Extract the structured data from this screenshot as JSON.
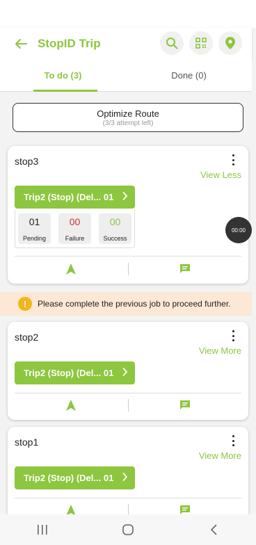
{
  "colors": {
    "brand_green": "#8dc63f",
    "failure_red": "#d32f2f",
    "warning_bg": "#fce8d5",
    "warning_icon": "#f5b41a"
  },
  "header": {
    "title": "StopID Trip",
    "icons": [
      "back-arrow-icon",
      "search-icon",
      "qr-code-icon",
      "location-pin-icon"
    ]
  },
  "tabs": [
    {
      "label": "To do (3)",
      "active": true
    },
    {
      "label": "Done (0)",
      "active": false
    }
  ],
  "optimize": {
    "label": "Optimize Route",
    "sublabel": "(3/3 attempt left)"
  },
  "stops": [
    {
      "name": "stop3",
      "view_toggle": "View Less",
      "trip_label": "Trip2 (Stop) (Del... 01",
      "stats": [
        {
          "value": "01",
          "label": "Pending"
        },
        {
          "value": "00",
          "label": "Failure"
        },
        {
          "value": "00",
          "label": "Success"
        }
      ]
    },
    {
      "name": "stop2",
      "view_toggle": "View More",
      "trip_label": "Trip2 (Stop) (Del... 01"
    },
    {
      "name": "stop1",
      "view_toggle": "View More",
      "trip_label": "Trip2 (Stop) (Del... 01"
    }
  ],
  "warning": {
    "text": "Please complete the previous job to proceed further.",
    "icon": "!"
  },
  "timer": {
    "text": "00:00"
  }
}
